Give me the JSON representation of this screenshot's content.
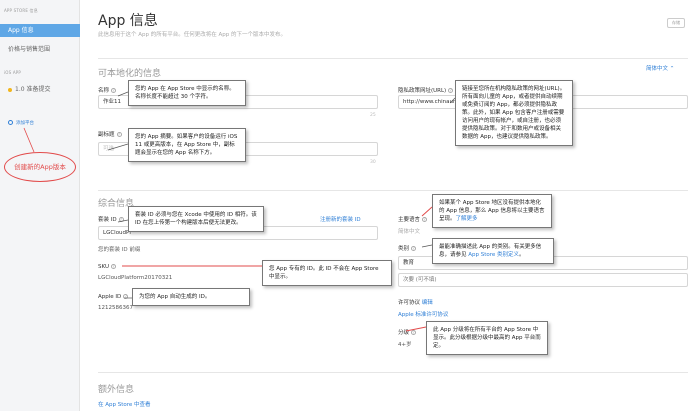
{
  "sidebar": {
    "section_store": "APP STORE 信息",
    "item_app_info": "App 信息",
    "item_pricing": "价格与销售范围",
    "section_ios": "iOS APP",
    "item_version": "1.0 准备提交",
    "item_add_platform": "添加平台",
    "callout": "创建新的App版本"
  },
  "header": {
    "title": "App 信息",
    "subtitle": "此信息用于这个 App 的所有平台。任何更改将在 App 的下一个版本中发布。",
    "top_button": "存储"
  },
  "localizable": {
    "section_title": "可本地化的信息",
    "language": "简体中文 ⌃",
    "name_label": "名称",
    "name_value": "作业11",
    "name_count": "25",
    "subtitle_label": "副标题",
    "subtitle_placeholder": "可选",
    "subtitle_count": "30",
    "privacy_label": "隐私政策网址(URL)",
    "privacy_value": "http://www.chinaunix.net"
  },
  "general": {
    "section_title": "综合信息",
    "bundle_label": "套装 ID",
    "bundle_value": "LGCloudPl",
    "bundle_link": "注册新的套装 ID",
    "prefix_label": "您的套装 ID 前缀",
    "sku_label": "SKU",
    "sku_value": "LGCloudPlatform20170321",
    "appleid_label": "Apple ID",
    "appleid_value": "1212586367",
    "primary_lang_label": "主要语言",
    "primary_lang_value": "简体中文",
    "category_label": "类别",
    "category_primary": "教育",
    "category_secondary": "次要 (可不填)",
    "license_label": "许可协议",
    "license_edit": "编辑",
    "license_value": "Apple 标准许可协议",
    "rating_label": "分级",
    "rating_value": "4+岁"
  },
  "additional": {
    "section_title": "额外信息",
    "link": "在 App Store 中查看"
  },
  "tooltips": {
    "name": "您的 App 在 App Store 中显示的名称。名称长度不能超过 30 个字符。",
    "subtitle": "您的 App 摘要。如果客户的设备运行 iOS 11 或更高版本，在 App Store 中，副标题会显示在您的 App 名称下方。",
    "privacy": "链接至您所在机构隐私政策的网址(URL)。所有面向儿童的 App，或者提供自动续期或免费订阅的 App，都必须提供隐私政策。此外，如果 App 包含客户注册或需要访问用户的现有帐户，或自注册，也必须提供隐私政策。对于和数用户或设备相关数据的 App，也建议提供隐私政策。",
    "bundle": "套装 ID 必须与您在 Xcode 中使用的 ID 相符。该 ID 在您上传第一个构建版本后便无法更改。",
    "sku": "您 App 专有的 ID。此 ID 不会在 App Store 中显示。",
    "appleid": "为您的 App 自动生成的 ID。",
    "primary_lang_text": "如果某个 App Store 地区没有提供本地化的 App 信息，那么 App 信息将以主要语言呈现。",
    "primary_lang_link": "了解更多",
    "category_text": "最能准确描述此 App 的类别。有关更多信息，请参见 ",
    "category_link": "App Store 类别定义",
    "category_end": "。",
    "rating": "此 App 分级将在所有平台的 App Store 中显示。此分级根据分级中最高的 App 平台而定。"
  }
}
